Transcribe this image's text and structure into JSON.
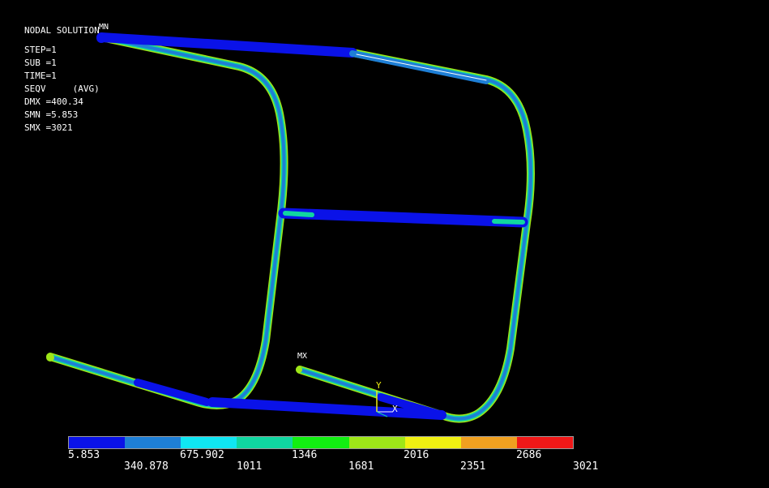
{
  "info": {
    "title": "NODAL SOLUTION",
    "step": "STEP=1",
    "sub": "SUB =1",
    "time": "TIME=1",
    "seqv": "SEQV     (AVG)",
    "dmx": "DMX =400.34",
    "smn": "SMN =5.853",
    "smx": "SMX =3021"
  },
  "markers": {
    "mn": "MN",
    "mx": "MX"
  },
  "triad": {
    "y": "Y",
    "x": "X"
  },
  "legend": {
    "colors": [
      "#0a12e8",
      "#1e7fd6",
      "#10e6f2",
      "#10d6a0",
      "#12ee12",
      "#9ee618",
      "#f0f012",
      "#f0a020",
      "#f01818"
    ],
    "labels_top_row": [
      "5.853",
      "675.902",
      "1346",
      "2016",
      "2686"
    ],
    "labels_bottom_row": [
      "340.878",
      "1011",
      "1681",
      "2351",
      "3021"
    ]
  },
  "colors": {
    "background": "#000000",
    "tube_low": "#0a12e8",
    "tube_mid": "#1e7fd6",
    "tube_edge": "#10d6a0",
    "tube_high": "#9ee618"
  }
}
